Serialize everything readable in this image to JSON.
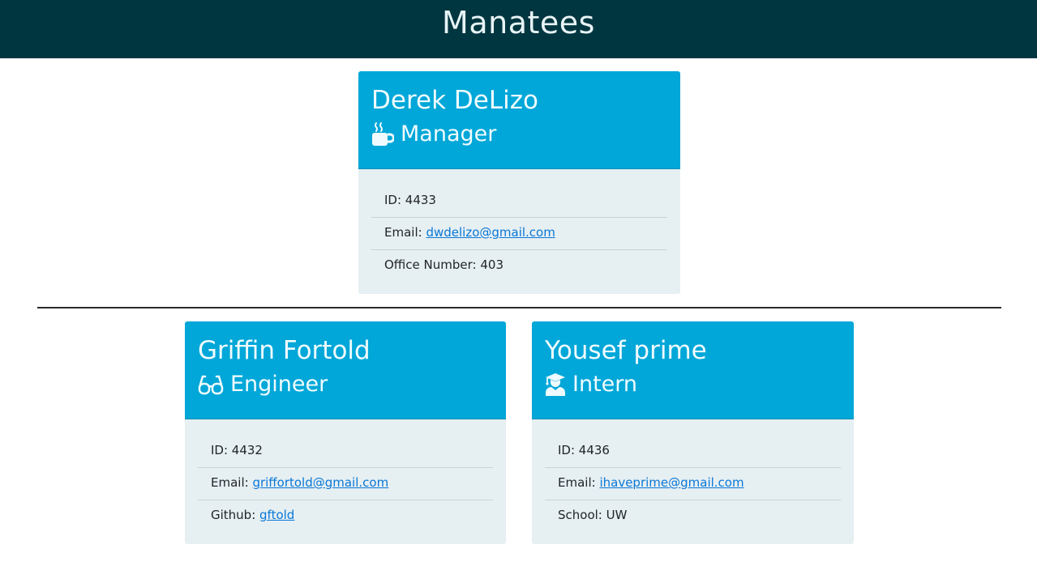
{
  "header": {
    "title": "Manatees"
  },
  "manager": {
    "name": "Derek DeLizo",
    "role": "Manager",
    "icon": "mug-icon",
    "id_label": "ID: ",
    "id": "4433",
    "email_label": "Email: ",
    "email": "dwdelizo@gmail.com",
    "office_label": "Office Number: ",
    "office": "403"
  },
  "engineer": {
    "name": "Griffin Fortold",
    "role": "Engineer",
    "icon": "glasses-icon",
    "id_label": "ID: ",
    "id": "4432",
    "email_label": "Email: ",
    "email": "griffortold@gmail.com",
    "github_label": "Github: ",
    "github": "gftold"
  },
  "intern": {
    "name": "Yousef prime",
    "role": "Intern",
    "icon": "graduate-icon",
    "id_label": "ID: ",
    "id": "4436",
    "email_label": "Email: ",
    "email": "ihaveprime@gmail.com",
    "school_label": "School: ",
    "school": "UW"
  },
  "colors": {
    "header_bg": "#003640",
    "card_head_bg": "#00a7d8",
    "card_body_bg": "#e6eff2",
    "link": "#0a77d6"
  }
}
